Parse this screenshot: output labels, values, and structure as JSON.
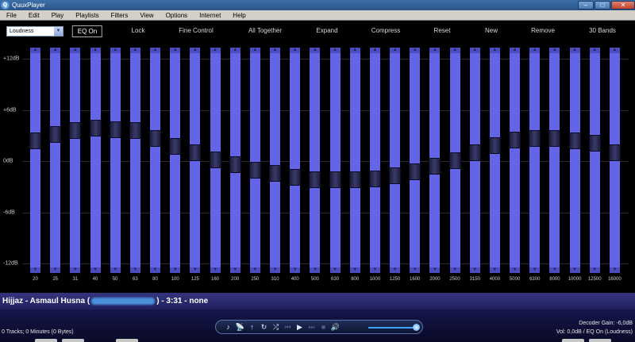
{
  "window": {
    "title": "QuuxPlayer",
    "app_icon_glyph": "Q"
  },
  "menu": [
    "File",
    "Edit",
    "Play",
    "Playlists",
    "Filters",
    "View",
    "Options",
    "Internet",
    "Help"
  ],
  "toolbar": {
    "preset": "Loudness",
    "buttons": [
      "EQ On",
      "Lock",
      "Fine Control",
      "All Together",
      "Expand",
      "Compress",
      "Reset",
      "New",
      "Remove",
      "30 Bands"
    ]
  },
  "db_scale": [
    "+12dB",
    "+6dB",
    "0dB",
    "-6dB",
    "-12dB"
  ],
  "bands": {
    "frequencies": [
      "20",
      "25",
      "31",
      "40",
      "50",
      "63",
      "80",
      "100",
      "125",
      "160",
      "200",
      "250",
      "310",
      "400",
      "500",
      "630",
      "800",
      "1000",
      "1250",
      "1600",
      "2000",
      "2500",
      "3150",
      "4000",
      "5000",
      "6300",
      "8000",
      "10000",
      "12500",
      "16000"
    ],
    "gain_db": [
      2.4,
      3.2,
      3.6,
      3.9,
      3.7,
      3.6,
      2.7,
      1.8,
      1.0,
      0.2,
      -0.4,
      -1.0,
      -1.4,
      -1.9,
      -2.1,
      -2.1,
      -2.1,
      -2.0,
      -1.7,
      -1.2,
      -0.6,
      0.1,
      1.0,
      1.9,
      2.5,
      2.7,
      2.7,
      2.4,
      2.1,
      1.0
    ]
  },
  "now_playing": {
    "prefix": "Hijjaz - Asmaul Husna (",
    "suffix": ") - 3:31 - none"
  },
  "status": {
    "tracks": "0 Tracks; 0 Minutes (0 Bytes)",
    "decoder_gain": "Decoder Gain: -6,0dB",
    "volume": "Vol: 0,0dB / EQ On (Loudness)"
  },
  "controls": [
    "♪",
    "📡",
    "↑",
    "↻",
    "⤮",
    "⏮",
    "▶",
    "⏭",
    "■",
    "🔊"
  ],
  "window_buttons": [
    "–",
    "□",
    "✕"
  ]
}
